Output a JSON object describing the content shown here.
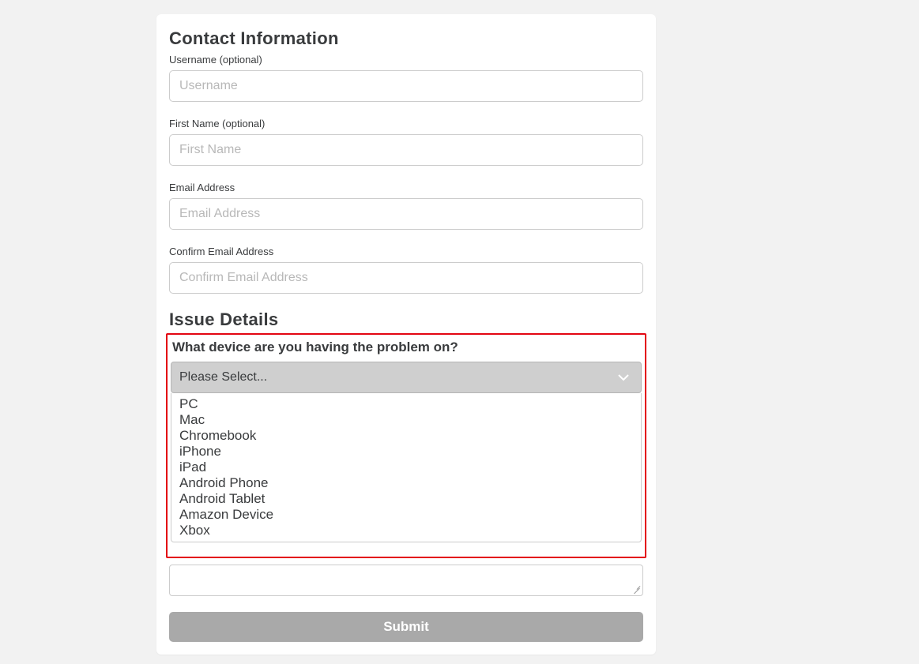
{
  "contact": {
    "title": "Contact Information",
    "username": {
      "label": "Username (optional)",
      "placeholder": "Username",
      "value": ""
    },
    "firstname": {
      "label": "First Name (optional)",
      "placeholder": "First Name",
      "value": ""
    },
    "email": {
      "label": "Email Address",
      "placeholder": "Email Address",
      "value": ""
    },
    "confirm_email": {
      "label": "Confirm Email Address",
      "placeholder": "Confirm Email Address",
      "value": ""
    }
  },
  "issue": {
    "title": "Issue Details",
    "device_question": "What device are you having the problem on?",
    "select_placeholder": "Please Select...",
    "options": [
      "PC",
      "Mac",
      "Chromebook",
      "iPhone",
      "iPad",
      "Android Phone",
      "Android Tablet",
      "Amazon Device",
      "Xbox"
    ]
  },
  "submit_label": "Submit",
  "colors": {
    "highlight_border": "#e30613",
    "card_bg": "#ffffff",
    "page_bg": "#f2f2f2",
    "select_bg": "#cfcfcf",
    "submit_bg": "#a9a9a9"
  }
}
